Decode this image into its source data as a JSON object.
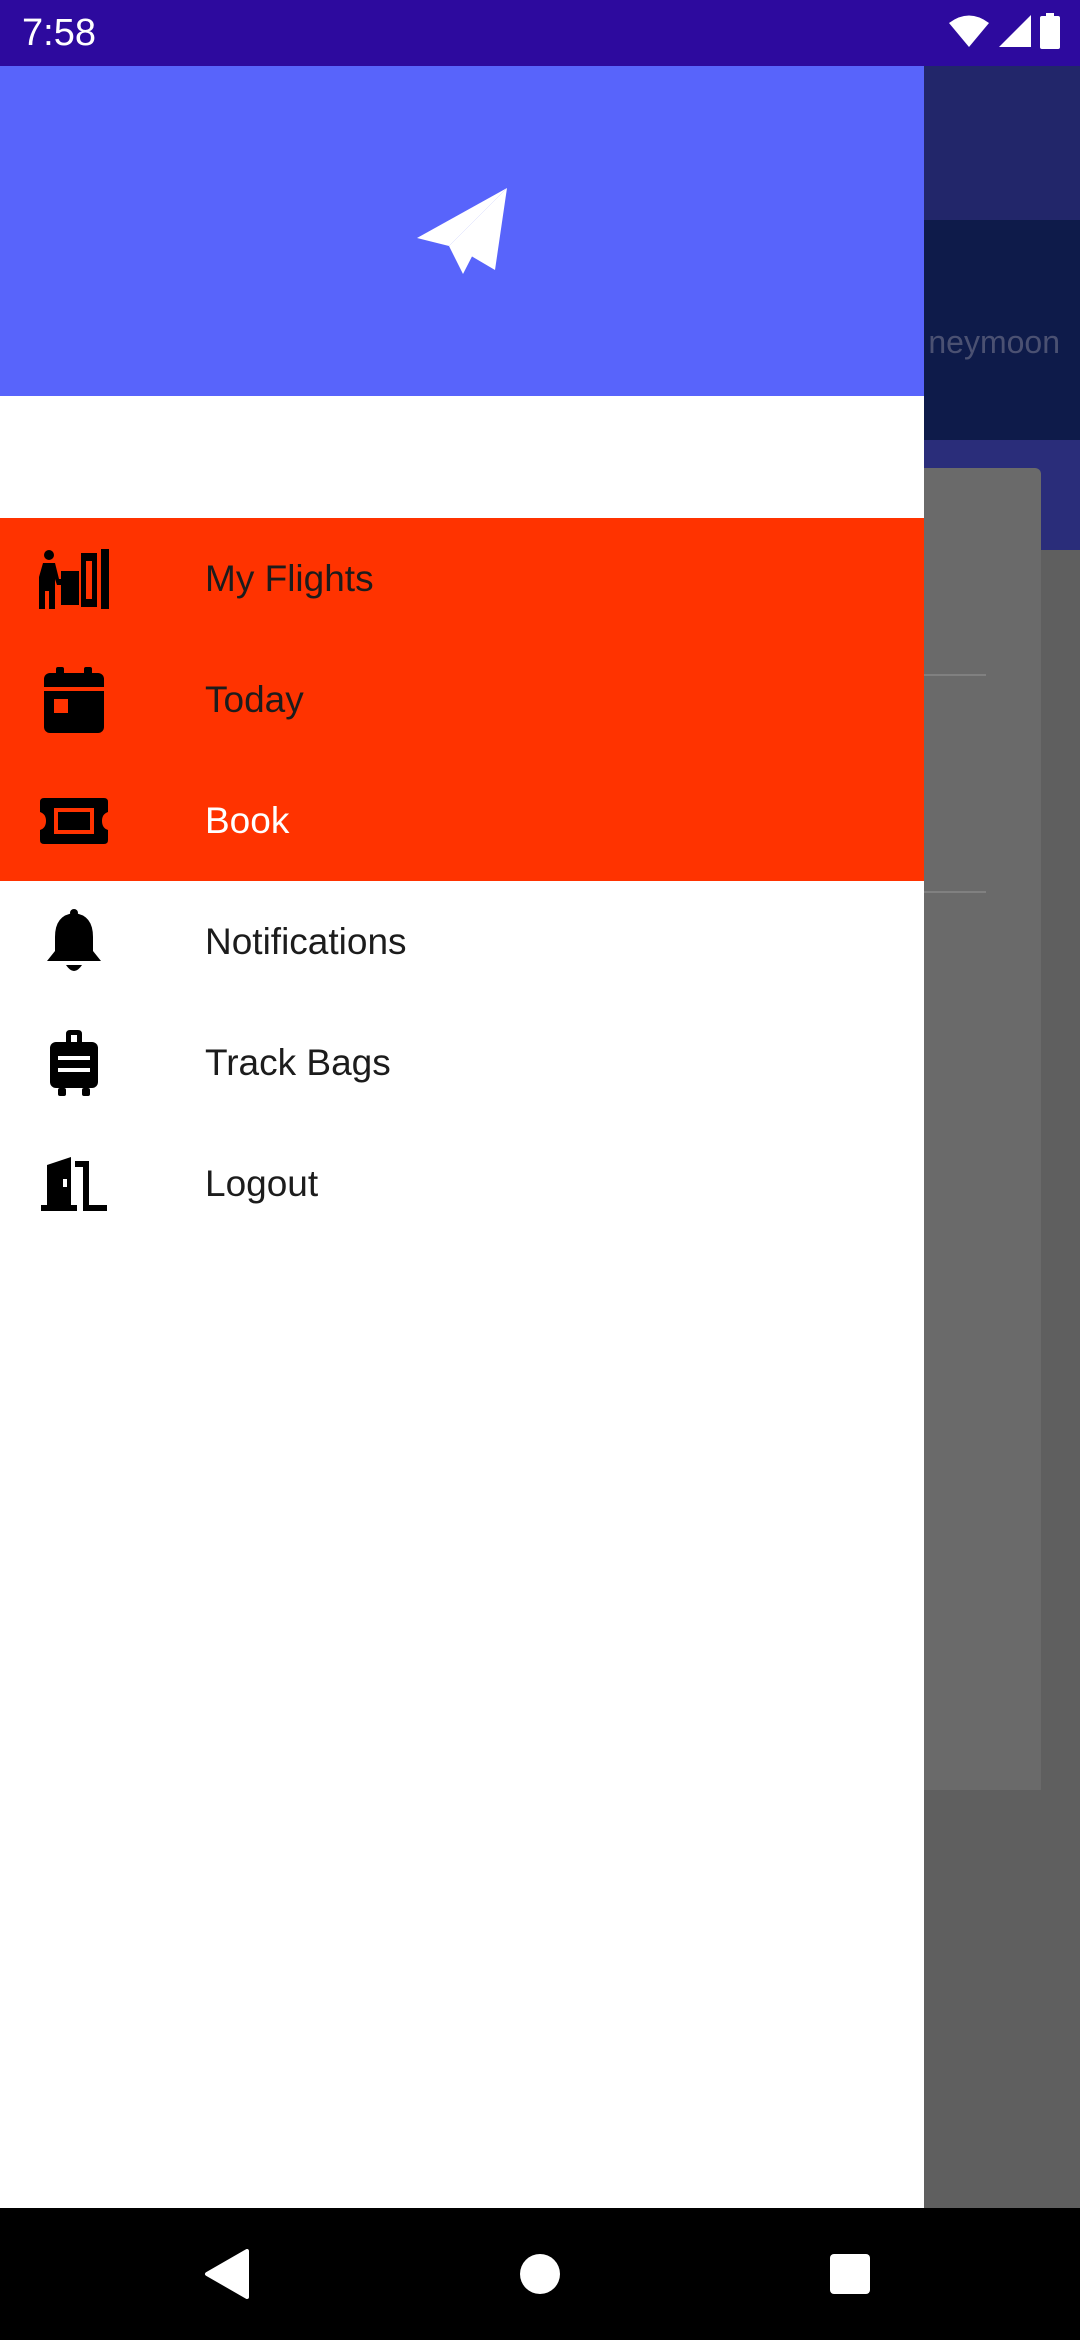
{
  "status_bar": {
    "time": "7:58",
    "icons": [
      "wifi-icon",
      "signal-icon",
      "battery-icon"
    ]
  },
  "background_app": {
    "tab_text": "neymoon"
  },
  "drawer": {
    "header": {
      "background_color": "#5864fb",
      "logo_icon": "paper-plane-icon"
    },
    "highlight_color": "#ff3300",
    "items": [
      {
        "label": "My Flights",
        "icon": "luggage-traveler-icon",
        "highlighted": true,
        "active": false
      },
      {
        "label": "Today",
        "icon": "calendar-icon",
        "highlighted": true,
        "active": false
      },
      {
        "label": "Book",
        "icon": "ticket-icon",
        "highlighted": true,
        "active": true
      },
      {
        "label": "Notifications",
        "icon": "bell-icon",
        "highlighted": false,
        "active": false
      },
      {
        "label": "Track Bags",
        "icon": "suitcase-icon",
        "highlighted": false,
        "active": false
      },
      {
        "label": "Logout",
        "icon": "door-exit-icon",
        "highlighted": false,
        "active": false
      }
    ]
  },
  "nav_bar": {
    "buttons": [
      "back-icon",
      "home-icon",
      "recents-icon"
    ]
  }
}
